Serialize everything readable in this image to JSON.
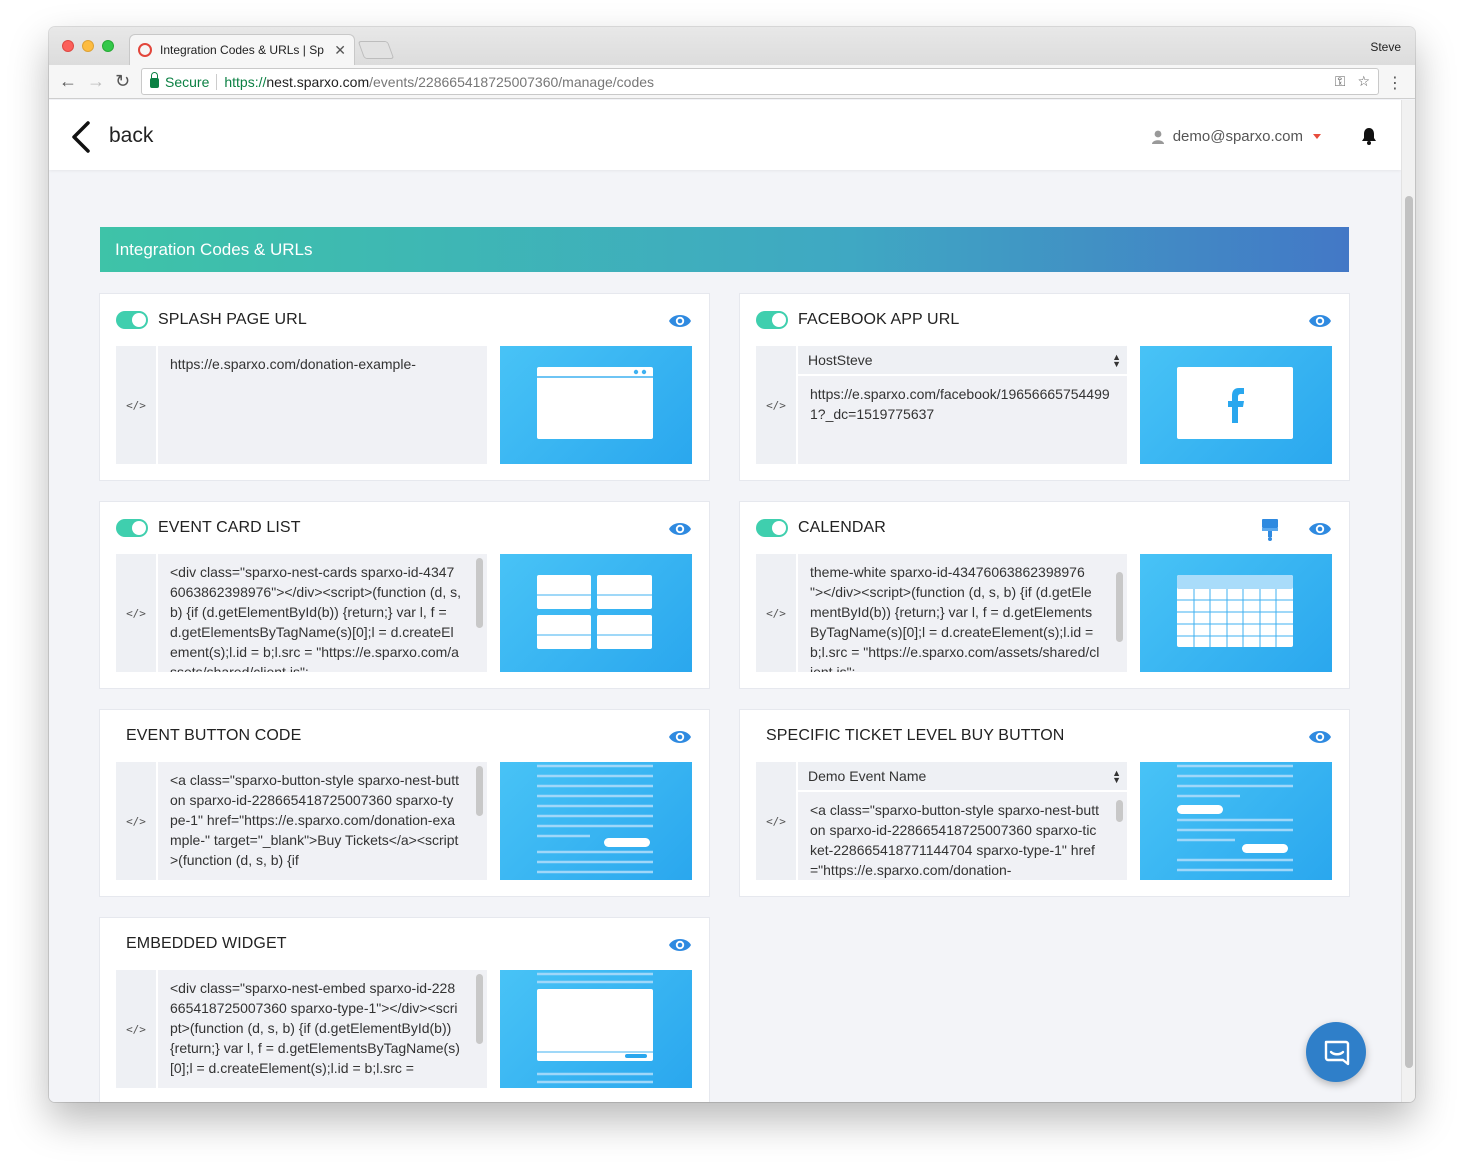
{
  "browser": {
    "tab_title": "Integration Codes & URLs | Sp",
    "profile": "Steve",
    "secure_label": "Secure",
    "url_scheme": "https://",
    "url_host": "nest.sparxo.com",
    "url_path": "/events/228665418725007360/manage/codes"
  },
  "header": {
    "back_label": "back",
    "user_email": "demo@sparxo.com"
  },
  "banner": {
    "title": "Integration Codes & URLs"
  },
  "cards": [
    {
      "title": "SPLASH PAGE URL",
      "enabled": true,
      "code_tag": "</>",
      "text": "https://e.sparxo.com/donation-example-",
      "preview": "browser-window"
    },
    {
      "title": "FACEBOOK APP URL",
      "enabled": true,
      "code_tag": "</>",
      "select_value": "HostSteve",
      "text": "https://e.sparxo.com/facebook/196566657544991?_dc=1519775637",
      "preview": "facebook-logo"
    },
    {
      "title": "EVENT CARD LIST",
      "enabled": true,
      "code_tag": "</>",
      "text": "<div class=\"sparxo-nest-cards sparxo-id-43476063862398976\"></div><script>(function (d, s, b) {if (d.getElementById(b)) {return;} var l, f = d.getElementsByTagName(s)[0];l = d.createElement(s);l.id = b;l.src = \"https://e.sparxo.com/assets/shared/client.js\";",
      "preview": "card-grid"
    },
    {
      "title": "CALENDAR",
      "enabled": true,
      "code_tag": "</>",
      "text": "theme-white sparxo-id-43476063862398976 \"></div><script>(function (d, s, b) {if (d.getElementById(b)) {return;} var l, f = d.getElementsByTagName(s)[0];l = d.createElement(s);l.id = b;l.src = \"https://e.sparxo.com/assets/shared/client.js\";",
      "preview": "calendar-grid"
    },
    {
      "title": "EVENT BUTTON CODE",
      "enabled": false,
      "code_tag": "</>",
      "text": "<a class=\"sparxo-button-style sparxo-nest-button sparxo-id-228665418725007360 sparxo-type-1\" href=\"https://e.sparxo.com/donation-example-\" target=\"_blank\">Buy Tickets</a><script>(function (d, s, b) {if",
      "preview": "page-with-button"
    },
    {
      "title": "SPECIFIC TICKET LEVEL BUY BUTTON",
      "enabled": false,
      "code_tag": "</>",
      "select_value": "Demo Event Name",
      "text": "<a class=\"sparxo-button-style sparxo-nest-button sparxo-id-228665418725007360 sparxo-ticket-228665418771144704 sparxo-type-1\" href=\"https://e.sparxo.com/donation-",
      "preview": "page-with-two-buttons"
    },
    {
      "title": "EMBEDDED WIDGET",
      "enabled": false,
      "code_tag": "</>",
      "text": "<div class=\"sparxo-nest-embed sparxo-id-228665418725007360 sparxo-type-1\"></div><script>(function (d, s, b) {if (d.getElementById(b)) {return;} var l, f = d.getElementsByTagName(s)[0];l = d.createElement(s);l.id = b;l.src =",
      "preview": "embedded-widget"
    }
  ],
  "colors": {
    "accent_toggle": "#3fcfae",
    "eye_icon": "#2f8ae0",
    "banner_start": "#3ec3a8",
    "banner_end": "#4378c6",
    "preview_bg": "#2aa7ee"
  }
}
